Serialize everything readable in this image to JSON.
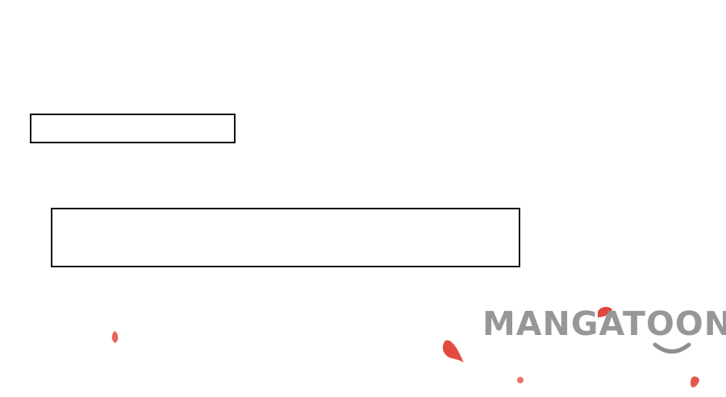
{
  "watermark": {
    "text": "MANGATOON",
    "color": "#8f8f8f"
  },
  "colors": {
    "background": "#ffffff",
    "panel_border": "#111111",
    "petal": "#e5564b"
  },
  "icons": {
    "petal": "petal-icon",
    "smile": "smile-icon"
  }
}
